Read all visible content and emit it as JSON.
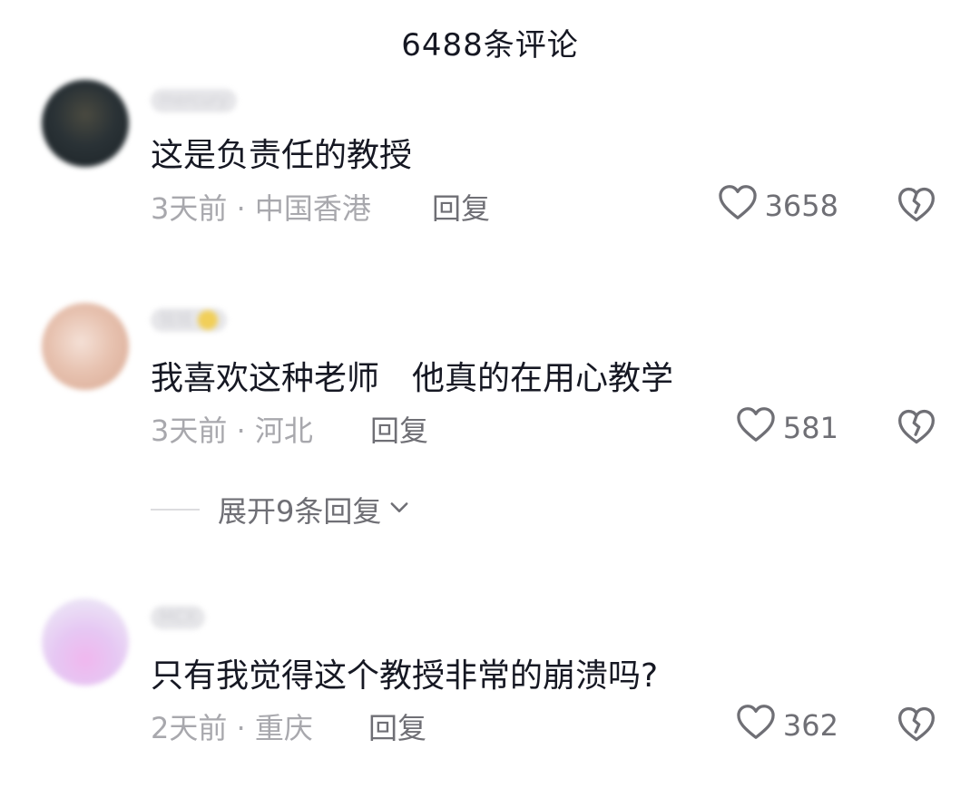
{
  "header": {
    "title": "6488条评论"
  },
  "comments": [
    {
      "username": "mercury",
      "text": "这是负责任的教授",
      "time": "3天前",
      "location": "中国香港",
      "reply_label": "回复",
      "likes": "3658"
    },
    {
      "username": "铭铭",
      "text": "我喜欢这种老师　他真的在用心教学",
      "time": "3天前",
      "location": "河北",
      "reply_label": "回复",
      "likes": "581",
      "expand_label": "展开9条回复"
    },
    {
      "username": "MCX",
      "text": "只有我觉得这个教授非常的崩溃吗?",
      "time": "2天前",
      "location": "重庆",
      "reply_label": "回复",
      "likes": "362"
    }
  ],
  "meta_separator": "·",
  "icons": {
    "like": "heart-outline-icon",
    "dislike": "broken-heart-icon",
    "expand": "chevron-down-icon"
  },
  "colors": {
    "text": "#161823",
    "secondary": "#a8a8ad",
    "action": "#6f6f75"
  }
}
